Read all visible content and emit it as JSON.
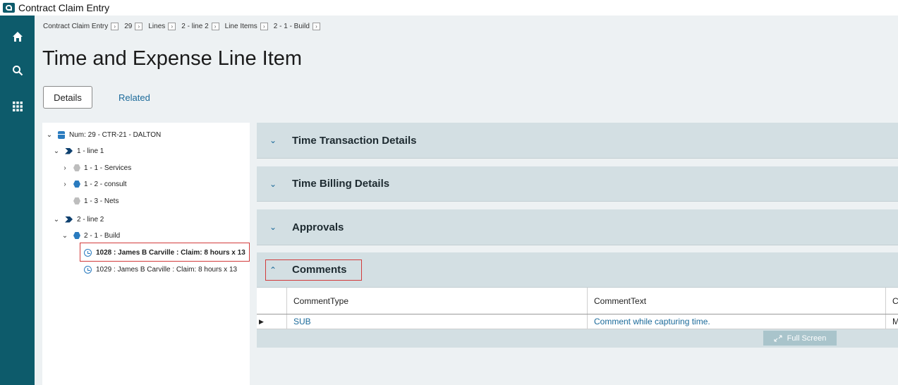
{
  "app": {
    "title": "Contract Claim Entry"
  },
  "nav": {
    "icons": [
      "home-icon",
      "search-icon",
      "apps-grid-icon"
    ]
  },
  "breadcrumb": [
    "Contract Claim Entry",
    "29",
    "Lines",
    "2 - line 2",
    "Line Items",
    "2 - 1 - Build"
  ],
  "page": {
    "title": "Time and Expense Line Item"
  },
  "tabs": {
    "details": "Details",
    "related": "Related"
  },
  "tree": {
    "root": "Num: 29 - CTR-21 - DALTON",
    "line1": "1 - line 1",
    "services": "1 - 1 - Services",
    "consult": "1 - 2 - consult",
    "nets": "1 - 3 - Nets",
    "line2": "2 - line 2",
    "build": "2 - 1 - Build",
    "item1028": "1028 : James B Carville : Claim: 8 hours x 13",
    "item1029": "1029 : James B Carville : Claim: 8 hours x 13"
  },
  "sections": {
    "time_transaction": "Time Transaction Details",
    "time_billing": "Time Billing Details",
    "approvals": "Approvals",
    "comments": "Comments"
  },
  "comments_grid": {
    "headers": [
      "CommentType",
      "CommentText",
      "Cl"
    ],
    "row": [
      "SUB",
      "Comment while capturing time.",
      "M"
    ],
    "full_screen": "Full Screen"
  },
  "colors": {
    "nav": "#0d5b6b",
    "link": "#1b6a9a",
    "highlight": "#d23b3b",
    "section": "#d3dfe3"
  }
}
